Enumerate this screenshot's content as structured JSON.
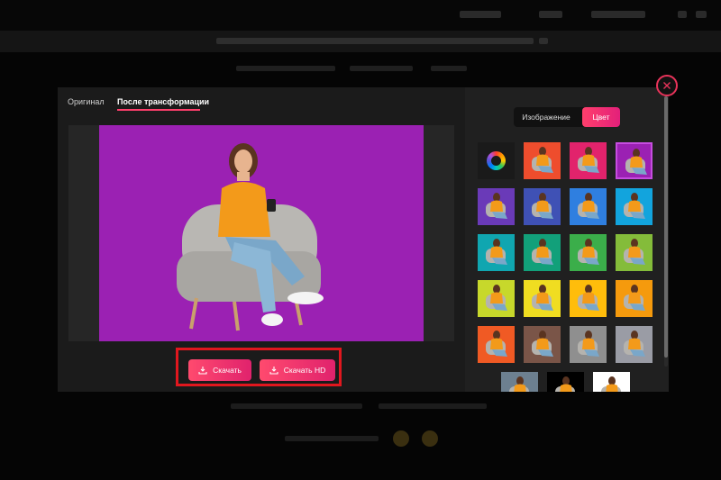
{
  "tabs": [
    {
      "label": "Оригинал",
      "active": false
    },
    {
      "label": "После трансформации",
      "active": true
    }
  ],
  "download": {
    "download_label": "Скачать",
    "download_hd_label": "Скачать HD"
  },
  "mode_toggle": [
    {
      "label": "Изображение",
      "active": false
    },
    {
      "label": "Цвет",
      "active": true
    }
  ],
  "background_colors": {
    "current": "#9b21b3",
    "swatches": [
      "color-wheel",
      "#ee4d2d",
      "#e2236c",
      "#9b21b3",
      "#6a3ab8",
      "#3f51b5",
      "#2f7fe0",
      "#12a4dd",
      "#10a6b0",
      "#12a07a",
      "#3bae4a",
      "#84bc3a",
      "#c7d82b",
      "#f0dd21",
      "#ffbd0b",
      "#f59a0d",
      "#f05a24",
      "#7a5548",
      "#8f8f8f",
      "#9a9ca5",
      "#6d8090",
      "#000000",
      "#ffffff"
    ],
    "selected_index": 3
  },
  "palette": {
    "accent": "#ff3f6c",
    "highlight": "#e1171e"
  },
  "icons": {
    "close": "close-icon",
    "download": "download-icon",
    "color_wheel": "color-wheel-icon"
  }
}
